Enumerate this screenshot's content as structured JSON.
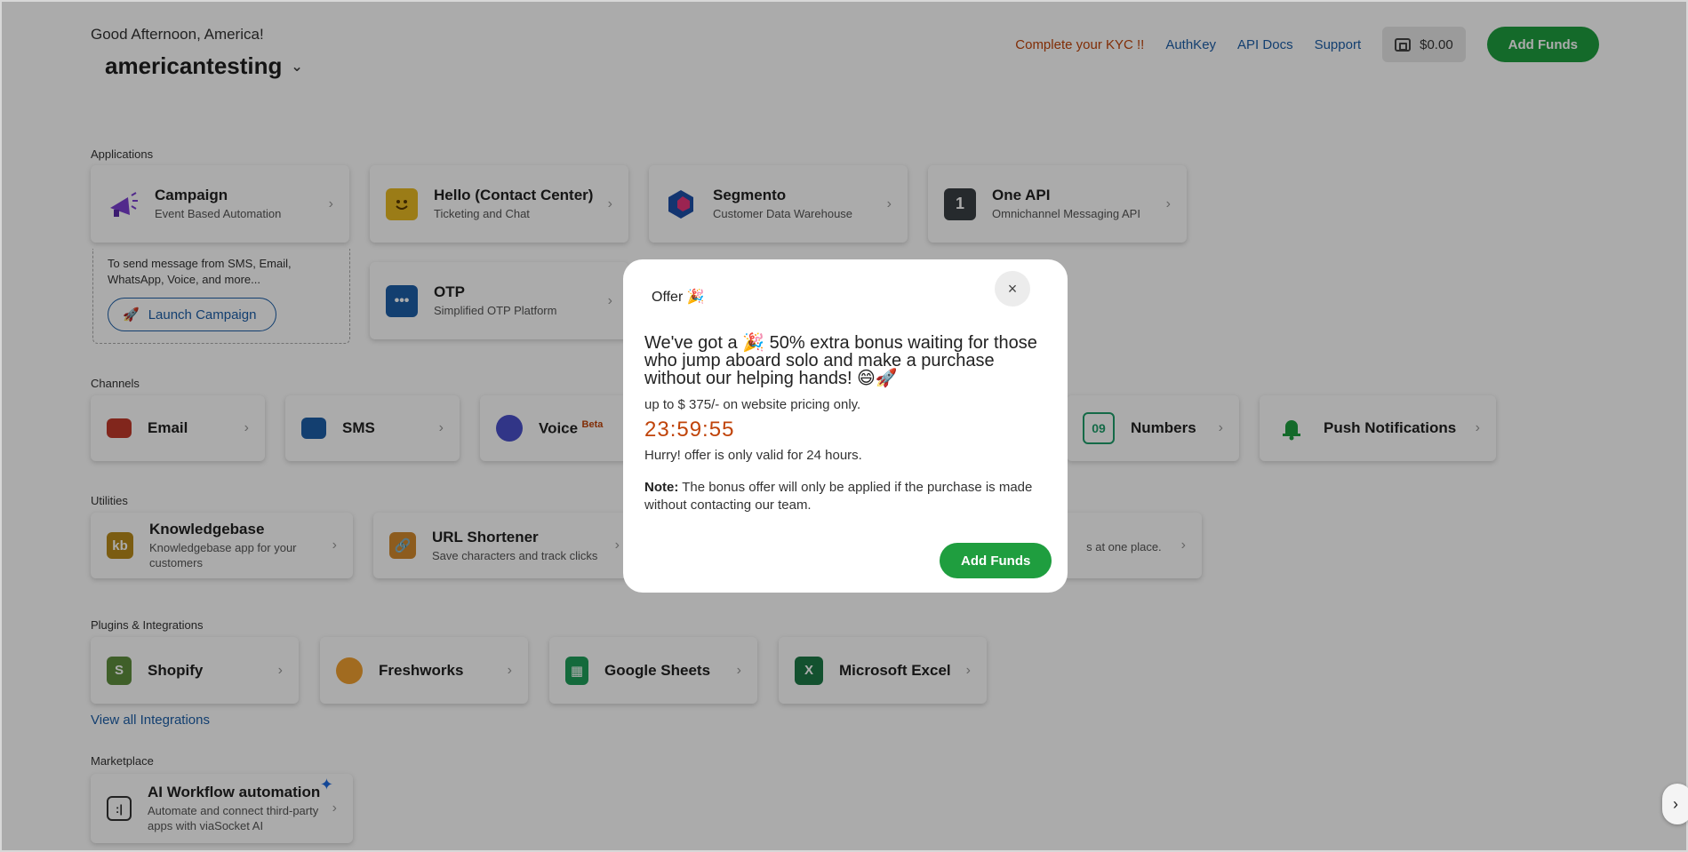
{
  "header": {
    "greeting": "Good Afternoon, America!",
    "company": "americantesting",
    "kyc_link": "Complete your KYC !!",
    "authkey_link": "AuthKey",
    "api_docs_link": "API Docs",
    "support_link": "Support",
    "balance": "$0.00",
    "add_funds": "Add Funds"
  },
  "sections": {
    "applications": "Applications",
    "channels": "Channels",
    "utilities": "Utilities",
    "plugins": "Plugins & Integrations",
    "marketplace": "Marketplace"
  },
  "applications": [
    {
      "title": "Campaign",
      "subtitle": "Event Based Automation"
    },
    {
      "title": "Hello (Contact Center)",
      "subtitle": "Ticketing and Chat"
    },
    {
      "title": "Segmento",
      "subtitle": "Customer Data Warehouse"
    },
    {
      "title": "One API",
      "subtitle": "Omnichannel Messaging API"
    },
    {
      "title": "OTP",
      "subtitle": "Simplified OTP Platform"
    }
  ],
  "campaign_note": "To send message from SMS, Email, WhatsApp, Voice, and more...",
  "launch_campaign": "Launch Campaign",
  "channels": [
    {
      "title": "Email"
    },
    {
      "title": "SMS"
    },
    {
      "title": "Voice",
      "badge": "Beta"
    },
    {
      "title": "Numbers"
    },
    {
      "title": "Push Notifications"
    }
  ],
  "utilities": [
    {
      "title": "Knowledgebase",
      "subtitle": "Knowledgebase app for your customers"
    },
    {
      "title": "URL Shortener",
      "subtitle": "Save characters and track clicks"
    },
    {
      "subtitle": "s at one place."
    }
  ],
  "plugins": [
    {
      "title": "Shopify"
    },
    {
      "title": "Freshworks"
    },
    {
      "title": "Google Sheets"
    },
    {
      "title": "Microsoft Excel"
    }
  ],
  "view_all": "View all Integrations",
  "marketplace": [
    {
      "title": "AI Workflow automation",
      "subtitle": "Automate and connect third-party apps with viaSocket AI"
    }
  ],
  "modal": {
    "title": "Offer 🎉",
    "close": "×",
    "headline": "We've got a 🎉 50% extra bonus waiting for those who jump aboard solo and make a purchase without our helping hands! 😄🚀",
    "sub": "up to $ 375/- on website pricing only.",
    "timer": "23:59:55",
    "hurry": "Hurry! offer is only valid for 24 hours.",
    "note_label": "Note:",
    "note_text": " The bonus offer will only be applied if the purchase is made without contacting our team.",
    "button": "Add Funds"
  },
  "colors": {
    "brand_green": "#1f9e3f",
    "link_blue": "#1d5fa8",
    "warning_orange": "#c0440a"
  },
  "icons": {
    "wallet": "wallet-icon",
    "chevron": "chevron-right-icon",
    "rocket": "rocket-icon"
  }
}
